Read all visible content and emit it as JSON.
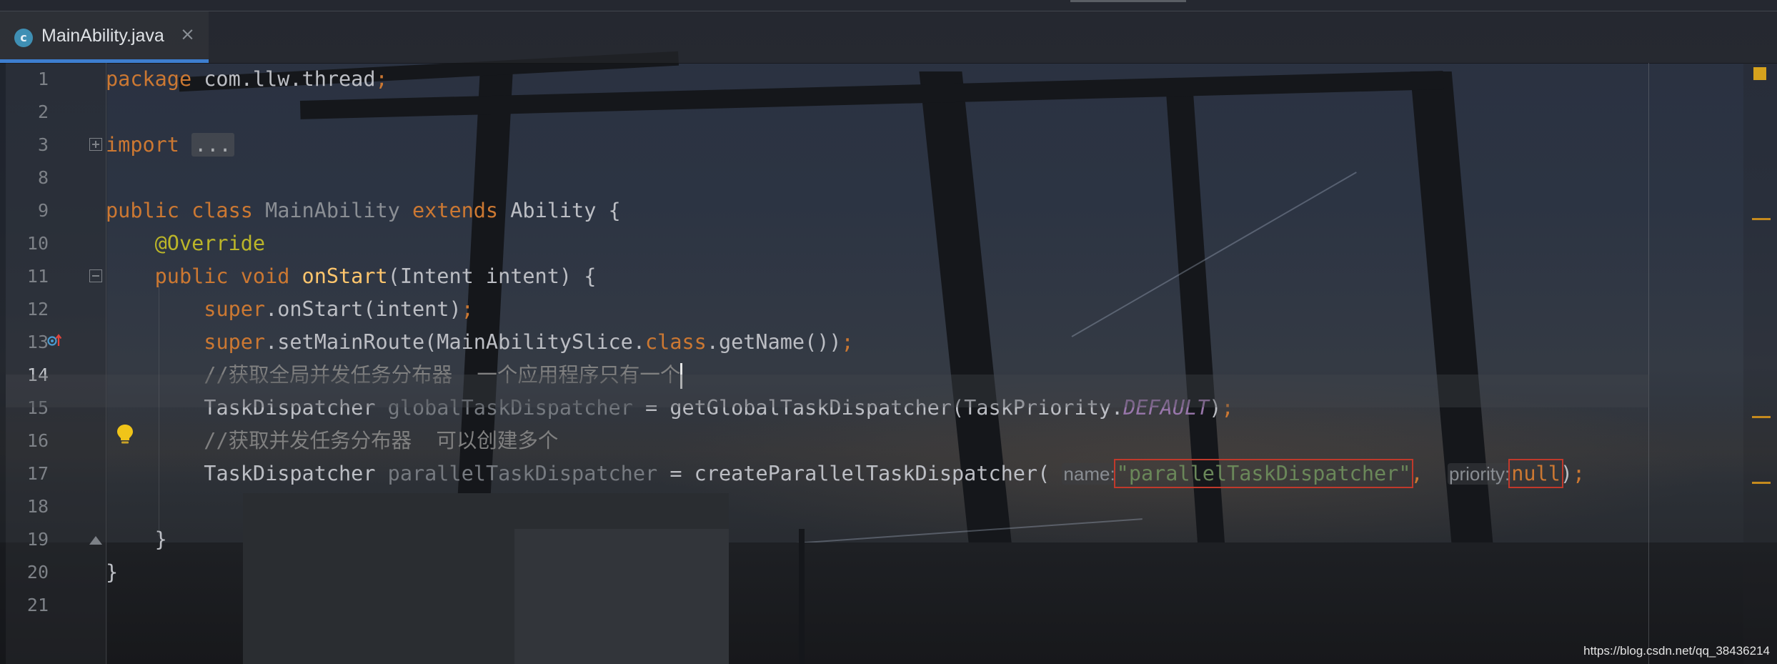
{
  "tab": {
    "icon_letter": "c",
    "title": "MainAbility.java",
    "close": "×"
  },
  "gutter": {
    "line_numbers": [
      "1",
      "2",
      "3",
      "8",
      "9",
      "10",
      "11",
      "12",
      "13",
      "14",
      "15",
      "16",
      "17",
      "18",
      "19",
      "20",
      "21"
    ],
    "active_line": "14"
  },
  "code": {
    "l1": {
      "kw": "package",
      "rest": " com.llw.thread",
      "semi": ";"
    },
    "l3": {
      "kw": "import",
      "placeholder": "..."
    },
    "l9": {
      "kw1": "public class ",
      "name": "MainAbility",
      "kw2": " extends ",
      "parent": "Ability",
      "brace": " {"
    },
    "l10": {
      "annotation": "@Override"
    },
    "l11": {
      "kw": "public void ",
      "method": "onStart",
      "params": "(Intent intent) {"
    },
    "l12": {
      "kw": "super",
      "rest": ".onStart(intent)",
      "semi": ";"
    },
    "l13": {
      "kw": "super",
      "rest": ".setMainRoute(MainAbilitySlice.",
      "kw2": "class",
      "rest2": ".getName())",
      "semi": ";"
    },
    "l14": {
      "comment": "//获取全局并发任务分布器  一个应用程序只有一个"
    },
    "l15": {
      "type": "TaskDispatcher ",
      "var": "globalTaskDispatcher",
      "mid": " = getGlobalTaskDispatcher(TaskPriority.",
      "const": "DEFAULT",
      "end": ")",
      "semi": ";"
    },
    "l16": {
      "comment": "//获取并发任务分布器  可以创建多个"
    },
    "l17": {
      "type": "TaskDispatcher ",
      "var": "parallelTaskDispatcher",
      "mid": " = createParallelTaskDispatcher( ",
      "hint1": "name:",
      "str": "\"parallelTaskDispatcher\"",
      "comma": ",",
      "hint2": "priority:",
      "null": "null",
      "end": ")",
      "semi": ";"
    },
    "l19": {
      "brace": "}"
    },
    "l20": {
      "brace": "}"
    }
  },
  "colors": {
    "keyword": "#cc7832",
    "string": "#6a8759",
    "comment": "#808080",
    "annotation": "#bbb529",
    "method_declaration": "#ffc66d",
    "static_constant": "#9876aa",
    "tab_underline": "#3d7ed0",
    "highlight_box": "#c0392b"
  },
  "icons": {
    "tab": "java-class-icon",
    "line11": "override-method-icon",
    "line14": "lightbulb-intention-icon",
    "top_right": "analysis-status-icon"
  },
  "watermark": "https://blog.csdn.net/qq_38436214"
}
